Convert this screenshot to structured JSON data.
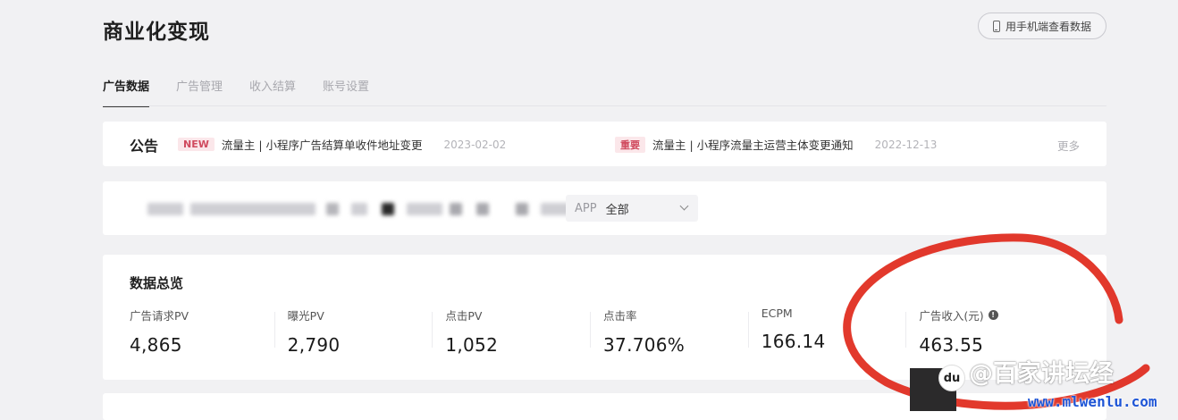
{
  "header": {
    "title": "商业化变现",
    "phone_button_label": "用手机端查看数据"
  },
  "tabs": [
    {
      "label": "广告数据",
      "active": true
    },
    {
      "label": "广告管理",
      "active": false
    },
    {
      "label": "收入结算",
      "active": false
    },
    {
      "label": "账号设置",
      "active": false
    }
  ],
  "notices": {
    "title": "公告",
    "items": [
      {
        "badge": "NEW",
        "text": "流量主 | 小程序广告结算单收件地址变更",
        "date": "2023-02-02"
      },
      {
        "badge": "重要",
        "text": "流量主 | 小程序流量主运营主体变更通知",
        "date": "2022-12-13"
      }
    ],
    "more_label": "更多"
  },
  "filter": {
    "app_label": "APP",
    "app_value": "全部"
  },
  "overview": {
    "title": "数据总览",
    "metrics": [
      {
        "label": "广告请求PV",
        "value": "4,865"
      },
      {
        "label": "曝光PV",
        "value": "2,790"
      },
      {
        "label": "点击PV",
        "value": "1,052"
      },
      {
        "label": "点击率",
        "value": "37.706%"
      },
      {
        "label": "ECPM",
        "value": "166.14"
      },
      {
        "label": "广告收入(元)",
        "value": "463.55",
        "info_icon": "info-icon"
      }
    ]
  },
  "watermark": {
    "logo_text": "du",
    "text": "@百家讲坛经",
    "url": "www.mlwenlu.com"
  },
  "colors": {
    "background": "#f1f1f3",
    "card": "#ffffff",
    "badge_bg": "#fbe7ea",
    "badge_text": "#d04a5e",
    "annotation_red": "#e02a1c",
    "watermark_url": "#1e55d6"
  }
}
